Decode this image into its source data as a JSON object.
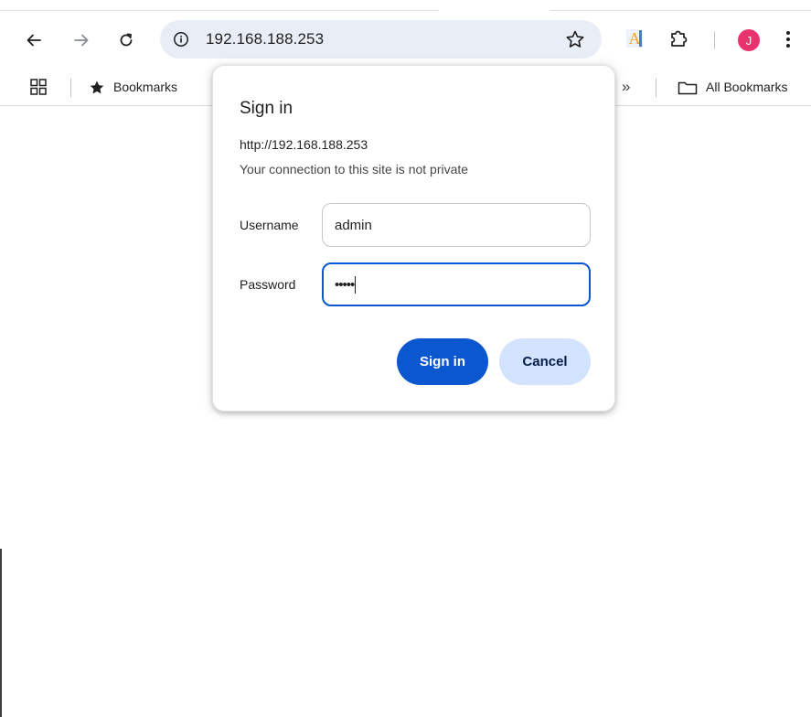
{
  "browser": {
    "address_url": "192.168.188.253",
    "icons": {
      "back": "back-arrow-icon",
      "forward": "forward-arrow-icon",
      "reload": "reload-icon",
      "site_info": "info-icon",
      "bookmark_star": "star-outline-icon",
      "reading_ext": "font-extension-icon",
      "extensions": "puzzle-icon",
      "menu": "more-vertical-icon"
    },
    "profile_initial": "J",
    "profile_color": "#e8336f"
  },
  "bookmarks_bar": {
    "bookmarks_label": "Bookmarks",
    "overflow_label": "»",
    "all_bookmarks_label": "All Bookmarks"
  },
  "dialog": {
    "title": "Sign in",
    "origin": "http://192.168.188.253",
    "warning": "Your connection to this site is not private",
    "username_label": "Username",
    "username_value": "admin",
    "password_label": "Password",
    "password_masked": "•••••",
    "sign_in_label": "Sign in",
    "cancel_label": "Cancel",
    "accent_color": "#0b57d0",
    "secondary_color": "#d3e3fd"
  }
}
